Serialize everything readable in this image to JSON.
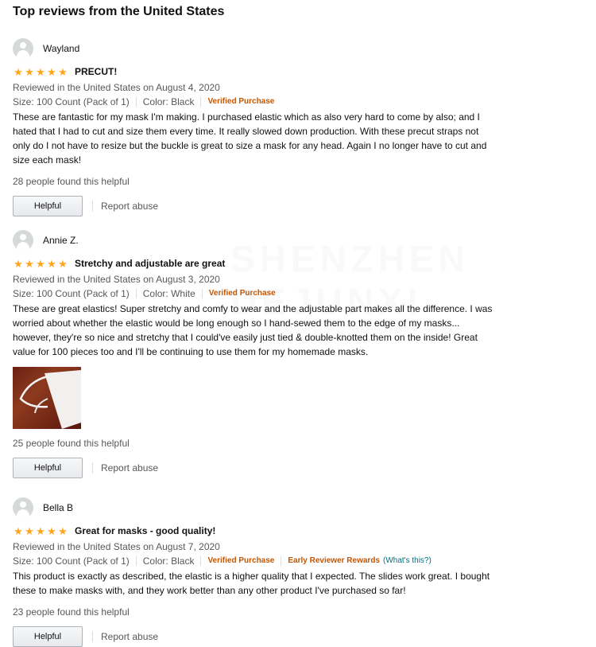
{
  "section": {
    "title": "Top reviews from the United States"
  },
  "reviews": [
    {
      "name": "Wayland",
      "title": "PRECUT!",
      "rating": 5,
      "date_line": "Reviewed in the United States on August 4, 2020",
      "size": "Size: 100 Count (Pack of 1)",
      "color": "Color: Black",
      "verified": "Verified Purchase",
      "body": "These are fantastic for my mask I'm making. I purchased elastic which as also very hard to come by also; and I hated that I had to cut and size them every time. It really slowed down production. With these precut straps not only do I not have to resize but the buckle is great to size a mask for any head. Again I no longer have to cut and size each mask!",
      "helpful_count": "28 people found this helpful",
      "helpful_label": "Helpful",
      "report_label": "Report abuse"
    },
    {
      "name": "Annie Z.",
      "title": "Stretchy and adjustable are great",
      "rating": 5,
      "date_line": "Reviewed in the United States on August 3, 2020",
      "size": "Size: 100 Count (Pack of 1)",
      "color": "Color: White",
      "verified": "Verified Purchase",
      "body": "These are great elastics! Super stretchy and comfy to wear and the adjustable part makes all the difference. I was worried about whether the elastic would be long enough so I hand-sewed them to the edge of my masks... however, they're so nice and stretchy that I could've easily just tied & double-knotted them on the inside! Great value for 100 pieces too and I'll be continuing to use them for my homemade masks.",
      "helpful_count": "25 people found this helpful",
      "helpful_label": "Helpful",
      "report_label": "Report abuse"
    },
    {
      "name": "Bella B",
      "title": "Great for masks - good quality!",
      "rating": 5,
      "date_line": "Reviewed in the United States on August 7, 2020",
      "size": "Size: 100 Count (Pack of 1)",
      "color": "Color: Black",
      "verified": "Verified Purchase",
      "early_reviewer": "Early Reviewer Rewards",
      "whats_this": "(What's this?)",
      "body": "This product is exactly as described, the elastic is a higher quality that I expected. The slides work great. I bought these to make masks with, and they work better than any other product I've purchased so far!",
      "helpful_count": "23 people found this helpful",
      "helpful_label": "Helpful",
      "report_label": "Report abuse"
    }
  ],
  "watermark": "SHENZHEN DEJUNXI",
  "colors": {
    "star": "#ffa41c",
    "verified": "#c45500",
    "link": "#007185",
    "muted": "#565959"
  },
  "icons": {
    "avatar": "default-avatar-icon",
    "star": "star-icon"
  }
}
